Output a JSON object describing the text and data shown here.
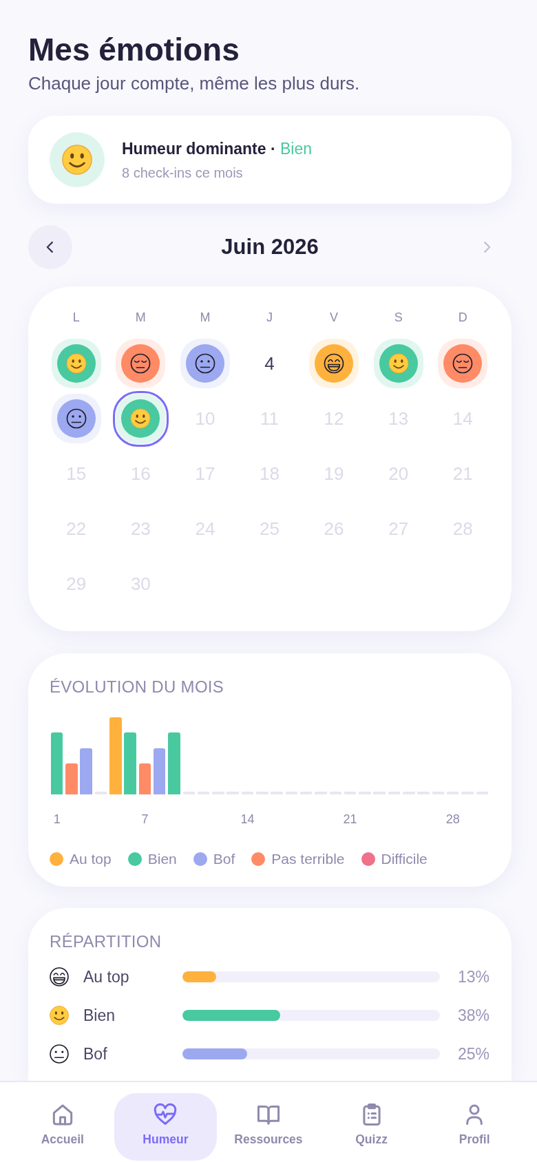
{
  "header": {
    "title": "Mes émotions",
    "subtitle": "Chaque jour compte, même les plus durs."
  },
  "summary": {
    "kind": "good",
    "label": "Humeur dominante ·",
    "value": "Bien",
    "detail": "8 check-ins ce mois"
  },
  "month_nav": {
    "title": "Juin 2026",
    "prev": {
      "disabled": false
    },
    "next": {
      "disabled": true
    }
  },
  "calendar": {
    "weekdays": [
      "L",
      "M",
      "M",
      "J",
      "V",
      "S",
      "D"
    ],
    "days": [
      {
        "kind": "good",
        "selected": false,
        "disabled": false
      },
      {
        "kind": "poor",
        "selected": false,
        "disabled": false
      },
      {
        "kind": "meh",
        "selected": false,
        "disabled": false
      },
      {
        "label": "4",
        "selected": false,
        "disabled": false
      },
      {
        "kind": "great",
        "selected": false,
        "disabled": false
      },
      {
        "kind": "good",
        "selected": false,
        "disabled": false
      },
      {
        "kind": "poor",
        "selected": false,
        "disabled": false
      },
      {
        "kind": "meh",
        "selected": false,
        "disabled": false
      },
      {
        "kind": "good",
        "selected": true,
        "disabled": false
      },
      {
        "label": "10",
        "selected": false,
        "disabled": true
      },
      {
        "label": "11",
        "selected": false,
        "disabled": true
      },
      {
        "label": "12",
        "selected": false,
        "disabled": true
      },
      {
        "label": "13",
        "selected": false,
        "disabled": true
      },
      {
        "label": "14",
        "selected": false,
        "disabled": true
      },
      {
        "label": "15",
        "selected": false,
        "disabled": true
      },
      {
        "label": "16",
        "selected": false,
        "disabled": true
      },
      {
        "label": "17",
        "selected": false,
        "disabled": true
      },
      {
        "label": "18",
        "selected": false,
        "disabled": true
      },
      {
        "label": "19",
        "selected": false,
        "disabled": true
      },
      {
        "label": "20",
        "selected": false,
        "disabled": true
      },
      {
        "label": "21",
        "selected": false,
        "disabled": true
      },
      {
        "label": "22",
        "selected": false,
        "disabled": true
      },
      {
        "label": "23",
        "selected": false,
        "disabled": true
      },
      {
        "label": "24",
        "selected": false,
        "disabled": true
      },
      {
        "label": "25",
        "selected": false,
        "disabled": true
      },
      {
        "label": "26",
        "selected": false,
        "disabled": true
      },
      {
        "label": "27",
        "selected": false,
        "disabled": true
      },
      {
        "label": "28",
        "selected": false,
        "disabled": true
      },
      {
        "label": "29",
        "selected": false,
        "disabled": true
      },
      {
        "label": "30",
        "selected": false,
        "disabled": true
      }
    ]
  },
  "evolution": {
    "title": "ÉVOLUTION DU MOIS",
    "days": [
      {
        "kind": "good",
        "label": "1"
      },
      {
        "kind": "poor"
      },
      {
        "kind": "meh"
      },
      {
        "kind": "empty"
      },
      {
        "kind": "great"
      },
      {
        "kind": "good"
      },
      {
        "kind": "poor",
        "label": "7"
      },
      {
        "kind": "meh"
      },
      {
        "kind": "good"
      },
      {
        "kind": "empty"
      },
      {
        "kind": "empty"
      },
      {
        "kind": "empty"
      },
      {
        "kind": "empty"
      },
      {
        "kind": "empty",
        "label": "14"
      },
      {
        "kind": "empty"
      },
      {
        "kind": "empty"
      },
      {
        "kind": "empty"
      },
      {
        "kind": "empty"
      },
      {
        "kind": "empty"
      },
      {
        "kind": "empty"
      },
      {
        "kind": "empty",
        "label": "21"
      },
      {
        "kind": "empty"
      },
      {
        "kind": "empty"
      },
      {
        "kind": "empty"
      },
      {
        "kind": "empty"
      },
      {
        "kind": "empty"
      },
      {
        "kind": "empty"
      },
      {
        "kind": "empty",
        "label": "28"
      },
      {
        "kind": "empty"
      },
      {
        "kind": "empty"
      }
    ],
    "legend": [
      {
        "kind": "great",
        "label": "Au top",
        "color": "#ffb13d"
      },
      {
        "kind": "good",
        "label": "Bien",
        "color": "#48c9a0"
      },
      {
        "kind": "meh",
        "label": "Bof",
        "color": "#9ca8ef"
      },
      {
        "kind": "poor",
        "label": "Pas terrible",
        "color": "#ff8a66"
      },
      {
        "kind": "bad",
        "label": "Difficile",
        "color": "#f07189"
      }
    ]
  },
  "repartition": {
    "title": "RÉPARTITION",
    "rows": [
      {
        "kind": "great",
        "label": "Au top",
        "level": 0.13,
        "percent": "13%"
      },
      {
        "kind": "good",
        "label": "Bien",
        "level": 0.38,
        "percent": "38%"
      },
      {
        "kind": "meh",
        "label": "Bof",
        "level": 0.25,
        "percent": "25%"
      }
    ]
  },
  "nav": {
    "items": [
      {
        "kind": "home",
        "label": "Accueil",
        "selected": false
      },
      {
        "kind": "heart",
        "label": "Humeur",
        "selected": true
      },
      {
        "kind": "book",
        "label": "Ressources",
        "selected": false
      },
      {
        "kind": "clipboard",
        "label": "Quizz",
        "selected": false
      },
      {
        "kind": "person",
        "label": "Profil",
        "selected": false
      }
    ]
  }
}
